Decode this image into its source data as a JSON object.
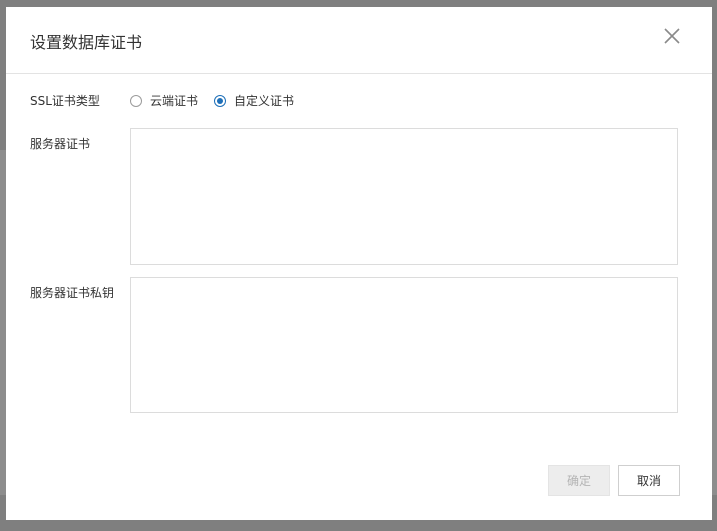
{
  "dialog": {
    "title": "设置数据库证书",
    "close_icon": "close-icon"
  },
  "form": {
    "ssl_type_label": "SSL证书类型",
    "ssl_options": [
      {
        "label": "云端证书",
        "checked": false
      },
      {
        "label": "自定义证书",
        "checked": true
      }
    ],
    "server_cert_label": "服务器证书",
    "server_cert_value": "",
    "server_key_label": "服务器证书私钥",
    "server_key_value": ""
  },
  "footer": {
    "ok_label": "确定",
    "cancel_label": "取消"
  },
  "colors": {
    "accent": "#1d6fb8",
    "disabled_text": "#b4b4b4",
    "overlay": "#7f7f7f"
  }
}
